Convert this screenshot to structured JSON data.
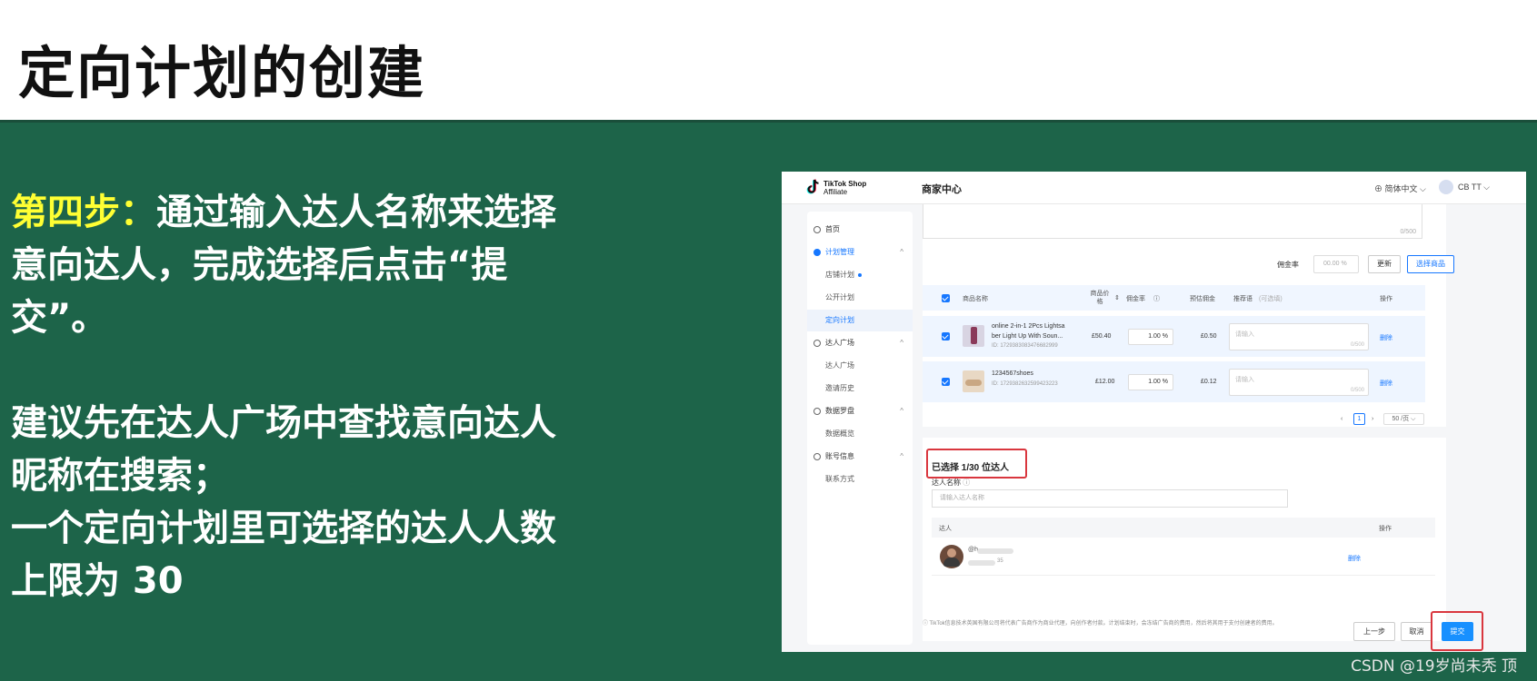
{
  "slide": {
    "title": "定向计划的创建",
    "step_label": "第四步：",
    "step_text_1": "通过输入达人名称来选择",
    "step_text_2": "意向达人，完成选择后点击“提",
    "step_text_3": "交”。",
    "tip_1": "建议先在达人广场中查找意向达人",
    "tip_2": "昵称在搜索；",
    "tip_3": "一个定向计划里可选择的达人人数",
    "tip_4": "上限为 30",
    "watermark": "CSDN @19岁尚未秃 顶"
  },
  "app": {
    "logo_line1": "TikTok Shop",
    "logo_line2": "Affiliate",
    "center_title": "商家中心",
    "language": "简体中文 ⌵",
    "user": "CB TT ⌵"
  },
  "sidebar": {
    "items": [
      {
        "label": "首页"
      },
      {
        "label": "计划管理"
      },
      {
        "label": "店铺计划"
      },
      {
        "label": "公开计划"
      },
      {
        "label": "定向计划"
      },
      {
        "label": "达人广场"
      },
      {
        "label": "达人广场"
      },
      {
        "label": "邀请历史"
      },
      {
        "label": "数据罗盘"
      },
      {
        "label": "数据概览"
      },
      {
        "label": "账号信息"
      },
      {
        "label": "联系方式"
      }
    ]
  },
  "products": {
    "textarea_count": "0/500",
    "rate_label": "佣金率",
    "rate_placeholder": "00.00 %",
    "update_button": "更新",
    "select_button": "选择商品",
    "columns": {
      "name": "商品名称",
      "price": "商品价格",
      "rate": "佣金率",
      "est": "预估佣金",
      "rec": "推荐语",
      "rec_hint": "(可选填)",
      "op": "操作"
    },
    "rows": [
      {
        "name1": "online 2-in-1 2Pcs Lightsa",
        "name2": "ber Light Up With Soun...",
        "id": "ID: 1729383083476682999",
        "price": "£50.40",
        "rate": "1.00 %",
        "est": "£0.50",
        "rec_placeholder": "请输入",
        "rec_count": "0/500",
        "op": "删除"
      },
      {
        "name1": "1234567shoes",
        "name2": "",
        "id": "ID: 1729382632599423223",
        "price": "£12.00",
        "rate": "1.00 %",
        "est": "£0.12",
        "rec_placeholder": "请输入",
        "rec_count": "0/500",
        "op": "删除"
      }
    ],
    "pager_prev": "‹",
    "pager_page": "1",
    "pager_next": "›",
    "pager_size": "50 /页 ⌵"
  },
  "creators": {
    "selected_title": "已选择 1/30 位达人",
    "name_label": "达人名称",
    "name_placeholder": "请输入达人名称",
    "col_creator": "达人",
    "col_op": "操作",
    "row_handle": "@h",
    "row_suffix": "35",
    "row_op": "删除"
  },
  "footer": {
    "note": "ⓘ TikTok信息技术英国有限公司将代表广告商作为商业代理，向创作者付款。计划结束时，会冻结广告商的费用，然后将其用于支付创建者的费用。",
    "prev_button": "上一步",
    "cancel_button": "取消",
    "submit_button": "提交"
  },
  "colors": {
    "slide_bg": "#1d6449",
    "highlight": "#ffff33",
    "accent": "#1677ff",
    "annotation_red": "#d9363e"
  }
}
